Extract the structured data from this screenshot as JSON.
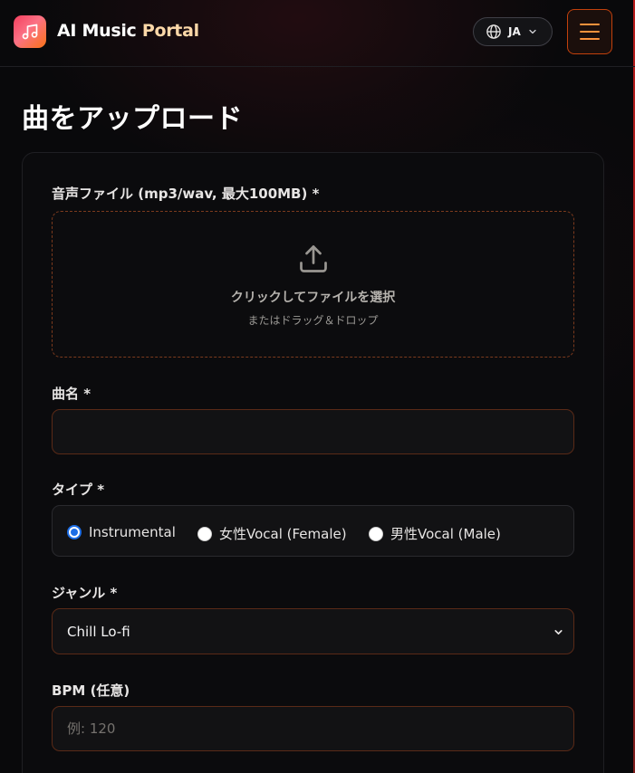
{
  "header": {
    "app_name_part1": "AI Music",
    "app_name_part2": "Portal",
    "logo_icon": "music-note-icon",
    "language": "JA",
    "menu_icon": "hamburger-icon"
  },
  "page": {
    "title": "曲をアップロード"
  },
  "form": {
    "audio": {
      "label": "音声ファイル (mp3/wav, 最大100MB) *",
      "dropzone_main": "クリックしてファイルを選択",
      "dropzone_sub": "またはドラッグ＆ドロップ",
      "icon": "upload-icon"
    },
    "song_name": {
      "label": "曲名 *",
      "value": "",
      "placeholder": ""
    },
    "type": {
      "label": "タイプ *",
      "options": [
        "Instrumental",
        "女性Vocal (Female)",
        "男性Vocal (Male)"
      ],
      "selected": "Instrumental"
    },
    "genre": {
      "label": "ジャンル *",
      "selected": "Chill Lo-fi"
    },
    "bpm": {
      "label": "BPM (任意)",
      "value": "",
      "placeholder": "例: 120"
    }
  },
  "colors": {
    "background": "#09090b",
    "accent": "#c2410c",
    "brand_highlight": "#fcd8a8",
    "radio_selected": "#1d6ee6"
  }
}
